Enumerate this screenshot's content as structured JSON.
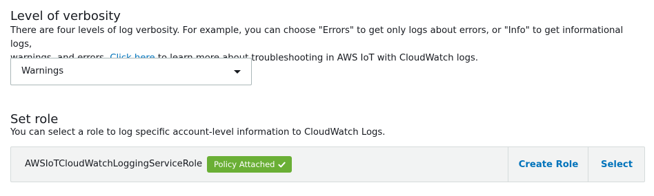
{
  "verbosity": {
    "title": "Level of verbosity",
    "description_part1": "There are four levels of log verbosity. For example, you can choose \"Errors\" to get only logs about errors, or \"Info\" to get informational logs,",
    "description_part2": "warnings, and errors.",
    "link_text": "Click here",
    "description_part3": "to learn more about troubleshooting in AWS IoT with CloudWatch logs.",
    "selected_value": "Warnings"
  },
  "role": {
    "title": "Set role",
    "description": "You can select a role to log specific account-level information to CloudWatch Logs.",
    "role_name": "AWSIoTCloudWatchLoggingServiceRole",
    "badge_label": "Policy Attached",
    "badge_color": "#6aaf35",
    "badge_icon": "check-icon",
    "create_label": "Create Role",
    "select_label": "Select"
  },
  "colors": {
    "link": "#0073bb",
    "text": "#16191f",
    "border": "#d5dbdb",
    "panel_bg": "#f2f3f3"
  }
}
